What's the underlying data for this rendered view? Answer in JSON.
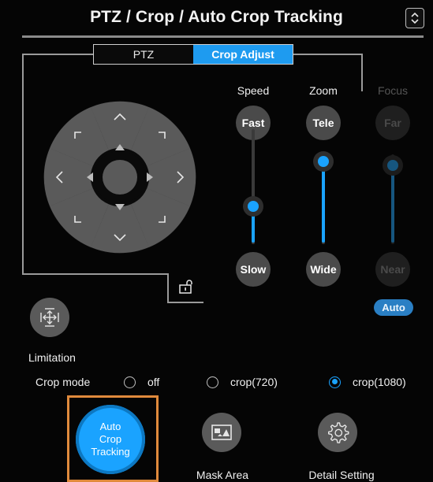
{
  "header": {
    "title": "PTZ / Crop / Auto Crop Tracking",
    "menu_icon": "up-down-chevron-icon"
  },
  "tabs": [
    {
      "label": "PTZ",
      "active": false
    },
    {
      "label": "Crop Adjust",
      "active": true
    }
  ],
  "pad": {
    "icons": [
      "arrow-up-icon",
      "arrow-down-icon",
      "arrow-left-icon",
      "arrow-right-icon",
      "corner-up-left-icon",
      "corner-up-right-icon",
      "corner-down-left-icon",
      "corner-down-right-icon",
      "center-button"
    ]
  },
  "speed": {
    "label": "Speed",
    "top_button": "Fast",
    "bottom_button": "Slow",
    "level": 0.35
  },
  "zoom": {
    "label": "Zoom",
    "top_button": "Tele",
    "bottom_button": "Wide",
    "level": 1.0
  },
  "focus": {
    "label": "Focus",
    "top_button": "Far",
    "bottom_button": "Near",
    "level": 0.95,
    "auto_label": "Auto",
    "enabled": false
  },
  "limitation": {
    "label": "Limitation"
  },
  "crop_mode": {
    "label": "Crop mode",
    "options": [
      {
        "label": "off",
        "selected": false
      },
      {
        "label": "crop(720)",
        "selected": false
      },
      {
        "label": "crop(1080)",
        "selected": true
      }
    ]
  },
  "actions": {
    "auto_crop": {
      "line1": "Auto",
      "line2": "Crop",
      "line3": "Tracking"
    },
    "mask_area": {
      "label": "Mask Area"
    },
    "detail_setting": {
      "label": "Detail Setting"
    }
  },
  "colors": {
    "accent": "#1aa3ff",
    "highlight": "#e08a3c",
    "button": "#4a4a4a"
  }
}
